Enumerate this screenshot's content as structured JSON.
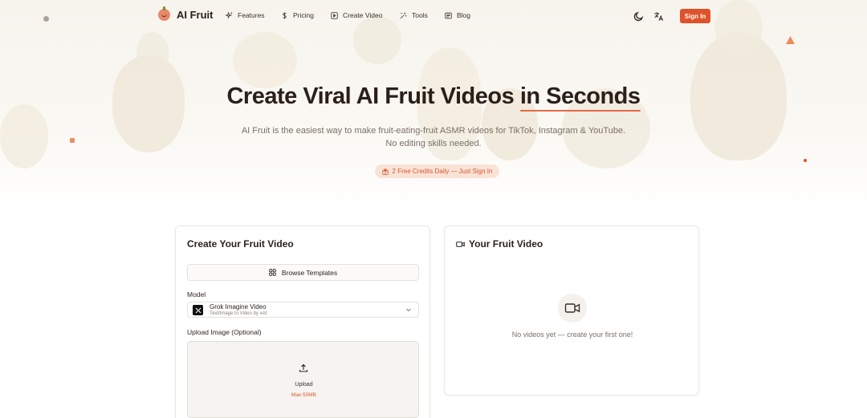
{
  "brand": {
    "name": "AI Fruit"
  },
  "nav": {
    "items": [
      {
        "label": "Features",
        "icon": "sparkles-icon"
      },
      {
        "label": "Pricing",
        "icon": "dollar-icon"
      },
      {
        "label": "Create Video",
        "icon": "play-square-icon"
      },
      {
        "label": "Tools",
        "icon": "wand-icon"
      },
      {
        "label": "Blog",
        "icon": "newspaper-icon"
      }
    ],
    "theme_icon": "moon-icon",
    "language_icon": "translate-icon",
    "signin_label": "Sign In"
  },
  "hero": {
    "title_part1": "Create Viral AI Fruit Videos ",
    "title_highlight": "in Seconds",
    "subtitle_line1": "AI Fruit is the easiest way to make fruit-eating-fruit ASMR videos for TikTok, Instagram & YouTube.",
    "subtitle_line2": "No editing skills needed.",
    "credits_label": "2 Free Credits Daily — Just Sign In"
  },
  "create_card": {
    "title": "Create Your Fruit Video",
    "browse_label": "Browse Templates",
    "model_label": "Model",
    "model": {
      "name": "Grok Imagine Video",
      "description": "Text/Image to Video by xAI"
    },
    "upload_label": "Upload Image (Optional)",
    "upload_text": "Upload",
    "upload_max": "Max 50MB"
  },
  "video_card": {
    "title": "Your Fruit Video",
    "empty_text": "No videos yet — create your first one!"
  },
  "colors": {
    "accent": "#e0522a",
    "badge_bg": "#f9e3d6",
    "text": "#2a1f1a"
  }
}
